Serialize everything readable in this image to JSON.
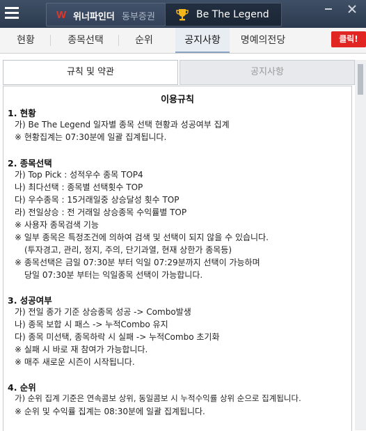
{
  "brand": {
    "name": "위너파인더",
    "sub": "동부증권"
  },
  "app": {
    "title": "Be The Legend"
  },
  "nav": [
    "현황",
    "종목선택",
    "순위",
    "공지사항",
    "명예의전당"
  ],
  "click_button": "클릭!",
  "subtabs": {
    "active": "규칙 및 약관",
    "inactive": "공지사항"
  },
  "doc": {
    "title": "이용규칙",
    "sections": [
      {
        "heading": "1. 현황",
        "lines": [
          "가) Be The Legend 일자별 종목 선택 현황과 성공여부 집계",
          "※ 현황집계는 07:30분에 일괄 집계됩니다."
        ]
      },
      {
        "heading": "2. 종목선택",
        "lines": [
          "가) Top Pick : 성적우수 종목 TOP4",
          "나) 최다선택 : 종목별 선택횟수 TOP",
          "다) 우수종목 : 15거래일중 상승달성 횟수 TOP",
          "라) 전일상승 : 전 거래일 상승종목 수익률별 TOP",
          "※ 사용자 종목검색 기능",
          "※ 일부 종목은 특정조건에 의하여 검색 및 선택이 되지 않을 수 있습니다.",
          "(투자경고, 관리, 정지, 주의, 단기과열, 현재 상한가 종목등)",
          "※ 종목선택은 금일 07:30분 부터 익일 07:29분까지 선택이 가능하며",
          "당일 07:30분 부터는 익일종목 선택이 가능합니다."
        ]
      },
      {
        "heading": "3. 성공여부",
        "lines": [
          "가) 전일 종가 기준 상승종목 성공 -> Combo발생",
          "나) 종목 보합 시 패스 -> 누적Combo 유지",
          "다) 종목 미선택, 종목하락 시 실패 -> 누적Combo 초기화",
          "※ 실패 시 바로 재 참여가 가능합니다.",
          "※ 매주 새로운 시즌이 시작됩니다."
        ]
      },
      {
        "heading": "4. 순위",
        "lines": [
          "가) 순위 집계 기준은 연속콤보 상위, 동일콤보 시 누적수익률 상위 순으로 집계됩니다.",
          "※ 순위 및 수익률 집계는 08:30분에 일괄 집계됩니다."
        ]
      }
    ]
  },
  "colors": {
    "titlebar": "#2f3e53",
    "accent": "#e02522"
  }
}
